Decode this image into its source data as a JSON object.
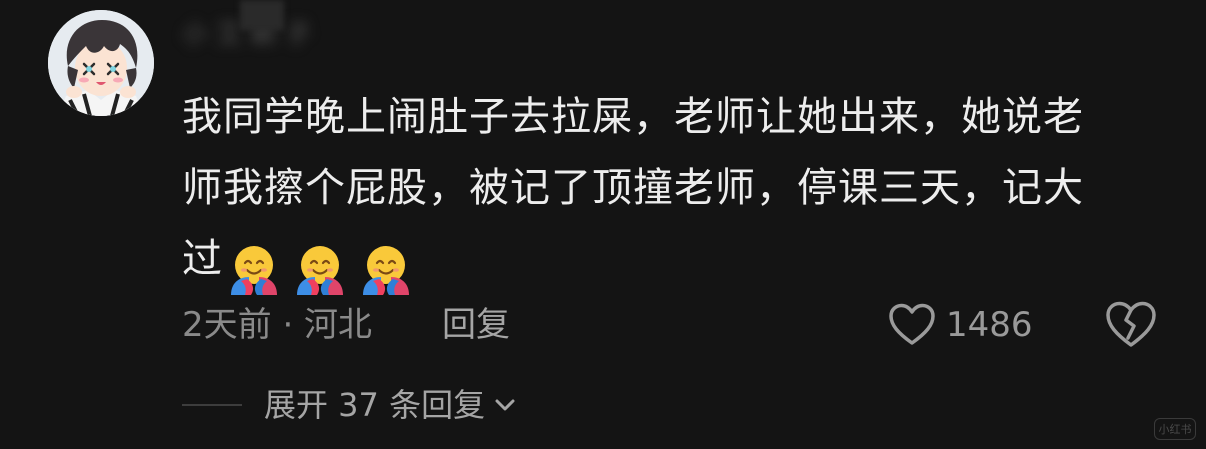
{
  "comment": {
    "avatar_icon": "anime-boy-avatar",
    "username": "小 艾 颖 子",
    "content_lines": [
      "我同学晚上闹肚子去拉屎，老师让她出来，她说老",
      "师我擦个屁股，被记了顶撞老师，停课三天，记大",
      "过"
    ],
    "emojis": [
      "hugging-face-emoji",
      "hugging-face-emoji",
      "hugging-face-emoji"
    ],
    "meta": "2天前 · 河北",
    "reply_label": "回复",
    "like_icon": "heart-outline-icon",
    "like_count": "1486",
    "dislike_icon": "broken-heart-icon",
    "expand_label": "展开 37 条回复",
    "expand_icon": "chevron-down-icon"
  },
  "watermark": "小红书",
  "colors": {
    "background": "#141414",
    "text": "#ededed",
    "muted": "#8a8a8a"
  }
}
